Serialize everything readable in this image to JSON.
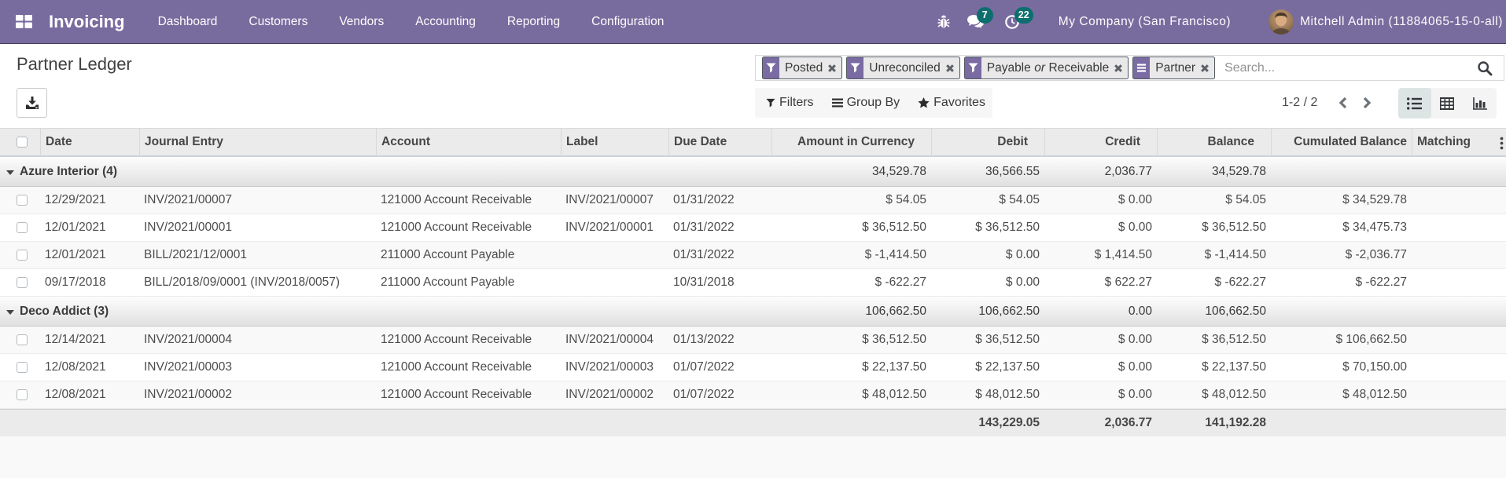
{
  "colors": {
    "navbar-bg": "#786b9e",
    "navbar-border": "#423f5c",
    "badge-bg": "#0d6e6e",
    "facet-icon-bg": "#7a6ba3",
    "facet-border": "#51585f",
    "facet-label-bg": "#e9e9e9"
  },
  "navbar": {
    "brand": "Invoicing",
    "menu_items": {
      "dashboard": "Dashboard",
      "customers": "Customers",
      "vendors": "Vendors",
      "accounting": "Accounting",
      "reporting": "Reporting",
      "configuration": "Configuration"
    },
    "messages_badge": "7",
    "activities_badge": "22",
    "company": "My Company (San Francisco)",
    "user": "Mitchell Admin (11884065-15-0-all)"
  },
  "control_panel": {
    "title": "Partner Ledger",
    "search": {
      "facets": {
        "posted": "Posted",
        "unreconciled": "Unreconciled",
        "payable_pre": "Payable",
        "payable_or": "or",
        "payable_post": "Receivable",
        "partner": "Partner"
      },
      "placeholder": "Search..."
    },
    "toolbar": {
      "filters": "Filters",
      "group_by": "Group By",
      "favorites": "Favorites"
    },
    "pager": {
      "text": "1-2 / 2"
    }
  },
  "table": {
    "columns": {
      "date": "Date",
      "journal": "Journal Entry",
      "account": "Account",
      "label": "Label",
      "due_date": "Due Date",
      "amount_currency": "Amount in Currency",
      "debit": "Debit",
      "credit": "Credit",
      "balance": "Balance",
      "cumulated": "Cumulated Balance",
      "matching": "Matching"
    },
    "groups": [
      {
        "name": "Azure Interior (4)",
        "agg": {
          "amount": "34,529.78",
          "debit": "36,566.55",
          "credit": "2,036.77",
          "balance": "34,529.78"
        },
        "rows": [
          {
            "date": "12/29/2021",
            "journal": "INV/2021/00007",
            "account": "121000 Account Receivable",
            "label": "INV/2021/00007",
            "due": "01/31/2022",
            "amount": "$ 54.05",
            "debit": "$ 54.05",
            "credit": "$ 0.00",
            "balance": "$ 54.05",
            "cumulated": "$ 34,529.78",
            "matching": ""
          },
          {
            "date": "12/01/2021",
            "journal": "INV/2021/00001",
            "account": "121000 Account Receivable",
            "label": "INV/2021/00001",
            "due": "01/31/2022",
            "amount": "$ 36,512.50",
            "debit": "$ 36,512.50",
            "credit": "$ 0.00",
            "balance": "$ 36,512.50",
            "cumulated": "$ 34,475.73",
            "matching": ""
          },
          {
            "date": "12/01/2021",
            "journal": "BILL/2021/12/0001",
            "account": "211000 Account Payable",
            "label": "",
            "due": "01/31/2022",
            "amount": "$ -1,414.50",
            "debit": "$ 0.00",
            "credit": "$ 1,414.50",
            "balance": "$ -1,414.50",
            "cumulated": "$ -2,036.77",
            "matching": ""
          },
          {
            "date": "09/17/2018",
            "journal": "BILL/2018/09/0001 (INV/2018/0057)",
            "account": "211000 Account Payable",
            "label": "",
            "due": "10/31/2018",
            "amount": "$ -622.27",
            "debit": "$ 0.00",
            "credit": "$ 622.27",
            "balance": "$ -622.27",
            "cumulated": "$ -622.27",
            "matching": ""
          }
        ]
      },
      {
        "name": "Deco Addict (3)",
        "agg": {
          "amount": "106,662.50",
          "debit": "106,662.50",
          "credit": "0.00",
          "balance": "106,662.50"
        },
        "rows": [
          {
            "date": "12/14/2021",
            "journal": "INV/2021/00004",
            "account": "121000 Account Receivable",
            "label": "INV/2021/00004",
            "due": "01/13/2022",
            "amount": "$ 36,512.50",
            "debit": "$ 36,512.50",
            "credit": "$ 0.00",
            "balance": "$ 36,512.50",
            "cumulated": "$ 106,662.50",
            "matching": ""
          },
          {
            "date": "12/08/2021",
            "journal": "INV/2021/00003",
            "account": "121000 Account Receivable",
            "label": "INV/2021/00003",
            "due": "01/07/2022",
            "amount": "$ 22,137.50",
            "debit": "$ 22,137.50",
            "credit": "$ 0.00",
            "balance": "$ 22,137.50",
            "cumulated": "$ 70,150.00",
            "matching": ""
          },
          {
            "date": "12/08/2021",
            "journal": "INV/2021/00002",
            "account": "121000 Account Receivable",
            "label": "INV/2021/00002",
            "due": "01/07/2022",
            "amount": "$ 48,012.50",
            "debit": "$ 48,012.50",
            "credit": "$ 0.00",
            "balance": "$ 48,012.50",
            "cumulated": "$ 48,012.50",
            "matching": ""
          }
        ]
      }
    ],
    "footer": {
      "debit": "143,229.05",
      "credit": "2,036.77",
      "balance": "141,192.28"
    }
  }
}
